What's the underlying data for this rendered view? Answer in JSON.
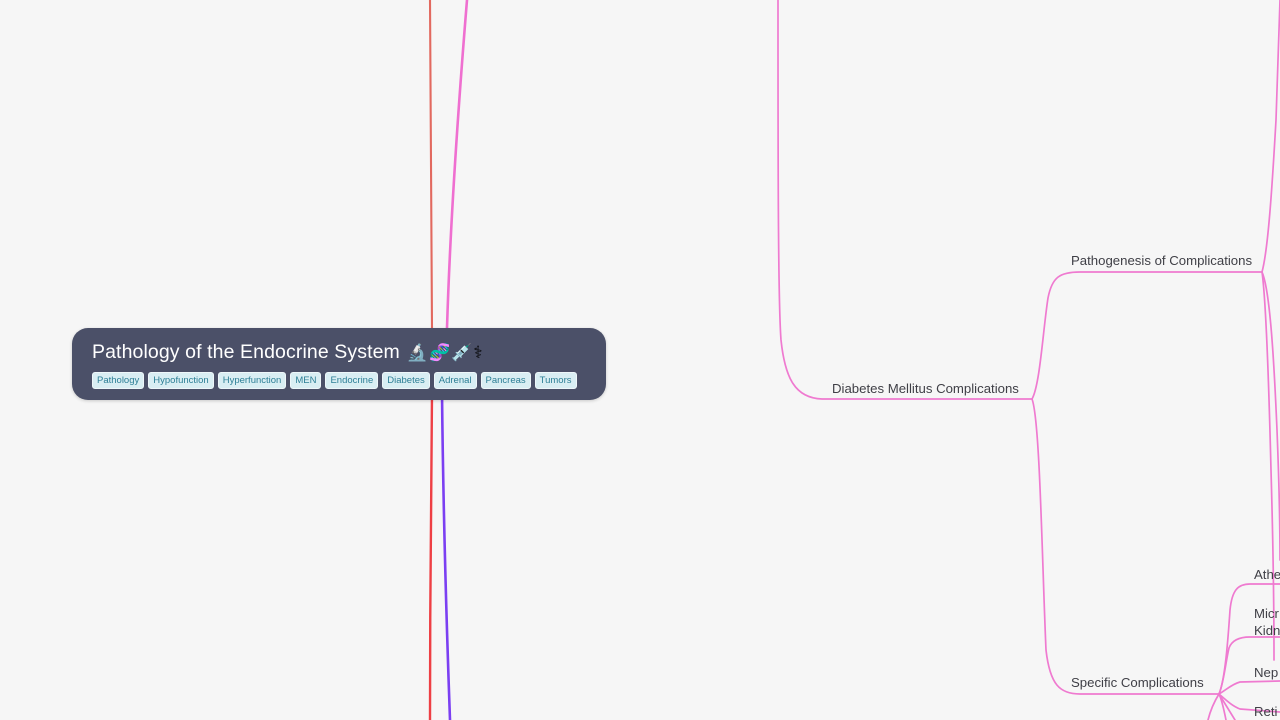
{
  "app": {
    "background_color": "#f6f6f6",
    "type": "mind-map"
  },
  "root": {
    "title": "Pathology of the Endocrine System",
    "emoji": "🔬🧬💉⚕",
    "background_color": "#4b5068",
    "text_color": "#ffffff",
    "tags": [
      "Pathology",
      "Hypofunction",
      "Hyperfunction",
      "MEN",
      "Endocrine",
      "Diabetes",
      "Adrenal",
      "Pancreas",
      "Tumors"
    ],
    "tag_background_color": "#d9eef3",
    "tag_text_color": "#2d7f96"
  },
  "branches": {
    "diabetes": {
      "label": "Diabetes Mellitus Complications",
      "color": "#ef7ad0"
    },
    "pathogenesis": {
      "label": "Pathogenesis of Complications",
      "color": "#ef7ad0"
    },
    "specific": {
      "label": "Specific Complications",
      "color": "#ef7ad0"
    },
    "leaves": [
      {
        "label": "Athe",
        "color": "#ef7ad0"
      },
      {
        "label": "Micr",
        "label2": "Kidn",
        "color": "#ef7ad0"
      },
      {
        "label": "Nep",
        "color": "#ef7ad0"
      },
      {
        "label": "Reti",
        "color": "#ef7ad0"
      }
    ]
  },
  "edge_colors": {
    "salmon": "#e2695f",
    "pink": "#ef6fd0",
    "red": "#ee3f44",
    "purple": "#7b3ff2",
    "magenta": "#ef7ad0"
  }
}
